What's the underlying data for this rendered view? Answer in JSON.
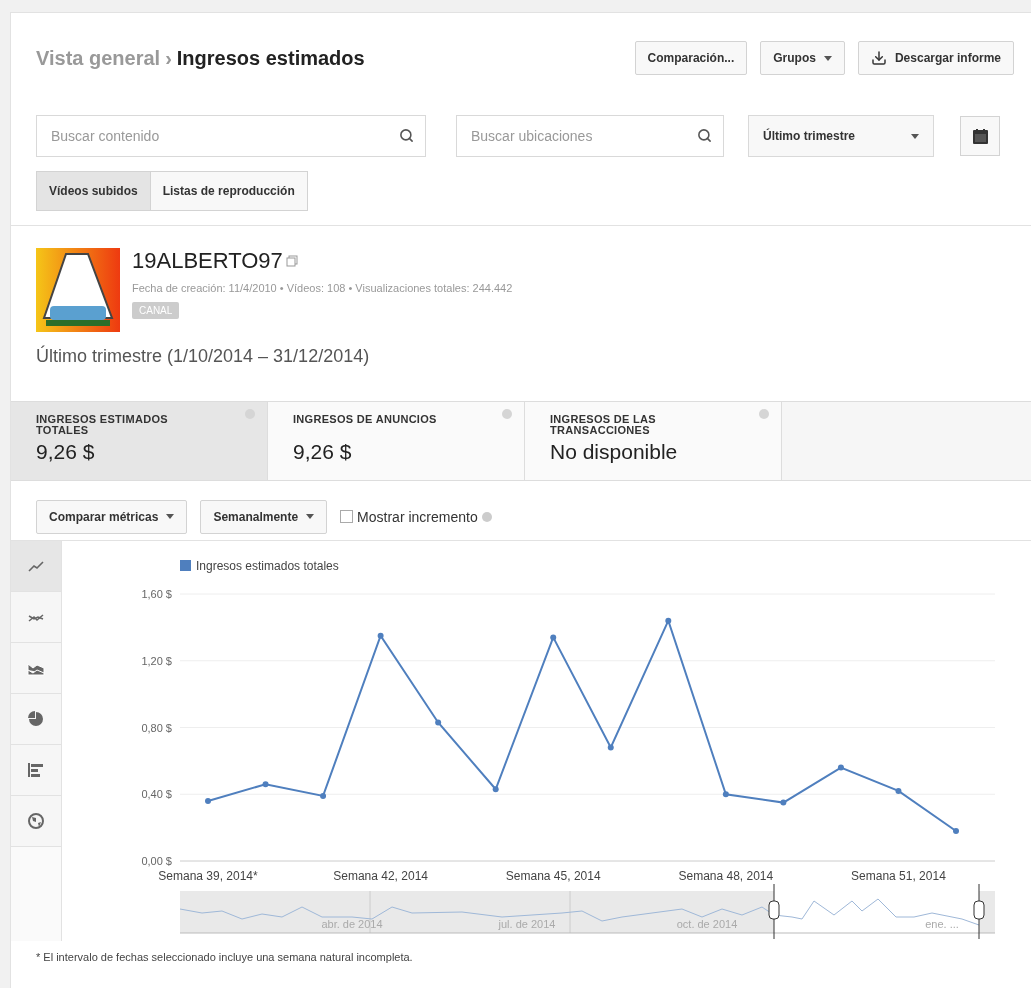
{
  "breadcrumb": {
    "parent": "Vista general",
    "separator": "›",
    "current": "Ingresos estimados"
  },
  "header_buttons": [
    {
      "label": "Comparación...",
      "kind": "plain"
    },
    {
      "label": "Grupos",
      "kind": "dropdown"
    },
    {
      "label": "Descargar informe",
      "kind": "download"
    }
  ],
  "search_fields": [
    {
      "placeholder": "Buscar contenido"
    },
    {
      "placeholder": "Buscar ubicaciones"
    }
  ],
  "period_select": {
    "value": "Último trimestre"
  },
  "content_tabs": [
    {
      "label": "Vídeos subidos",
      "selected": true
    },
    {
      "label": "Listas de reproducción",
      "selected": false
    }
  ],
  "channel": {
    "name": "19ALBERTO97",
    "meta": "Fecha de creación: 11/4/2010 • Vídeos: 108 • Visualizaciones totales: 244.442",
    "badge": "CANAL"
  },
  "period_label": "Último trimestre (1/10/2014 – 31/12/2014)",
  "metrics": [
    {
      "label": "INGRESOS ESTIMADOS TOTALES",
      "value": "9,26 $",
      "selected": true
    },
    {
      "label": "INGRESOS DE ANUNCIOS",
      "value": "9,26 $",
      "selected": false
    },
    {
      "label": "INGRESOS DE LAS TRANSACCIONES",
      "value": "No disponible",
      "selected": false
    }
  ],
  "chart_controls": [
    {
      "label": "Comparar métricas",
      "kind": "dropdown"
    },
    {
      "label": "Semanalmente",
      "kind": "dropdown"
    },
    {
      "label": "Mostrar incremento",
      "kind": "checkbox",
      "checked": false
    }
  ],
  "chart_types": [
    {
      "kind": "line",
      "selected": true
    },
    {
      "kind": "multiline",
      "selected": false
    },
    {
      "kind": "area",
      "selected": false
    },
    {
      "kind": "pie",
      "selected": false
    },
    {
      "kind": "bar",
      "selected": false
    },
    {
      "kind": "map",
      "selected": false
    }
  ],
  "chart_data": {
    "type": "line",
    "categories": [
      "Semana 39, 2014*",
      null,
      null,
      "Semana 42, 2014",
      null,
      null,
      "Semana 45, 2014",
      null,
      null,
      "Semana 48, 2014",
      null,
      null,
      "Semana 51, 2014",
      null
    ],
    "ylim": [
      0,
      1.6
    ],
    "grid": true,
    "yticks": [
      {
        "value": 0,
        "label": "0,00 $"
      },
      {
        "value": 0.4,
        "label": "0,40 $"
      },
      {
        "value": 0.8,
        "label": "0,80 $"
      },
      {
        "value": 1.2,
        "label": "1,20 $"
      },
      {
        "value": 1.6,
        "label": "1,60 $"
      }
    ],
    "series": [
      {
        "name": "Ingresos estimados totales",
        "color": "#4f7fbe",
        "marker": "circle",
        "values": [
          0.36,
          0.46,
          0.39,
          1.35,
          0.83,
          0.43,
          1.34,
          0.68,
          1.44,
          0.4,
          0.35,
          0.56,
          0.42,
          0.18
        ]
      }
    ]
  },
  "navigator": {
    "labels": [
      "abr. de 2014",
      "jul. de 2014",
      "oct. de 2014",
      "ene. ..."
    ]
  },
  "footnote": "* El intervalo de fechas seleccionado incluye una semana natural incompleta."
}
